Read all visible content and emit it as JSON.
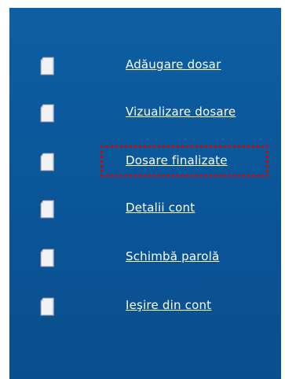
{
  "menu": {
    "items": [
      {
        "label": "Adăugare dosar",
        "icon": "document-icon"
      },
      {
        "label": "Vizualizare dosare",
        "icon": "document-icon"
      },
      {
        "label": "Dosare finalizate",
        "icon": "document-icon",
        "focused": true
      },
      {
        "label": "Detalii cont",
        "icon": "document-icon"
      },
      {
        "label": "Schimbă parolă",
        "icon": "document-icon"
      },
      {
        "label": "Ieşire din cont",
        "icon": "document-icon"
      }
    ]
  },
  "colors": {
    "panel_background": "#0a5597",
    "link_text": "#ffffff",
    "focus_outline": "#e00000",
    "page_background": "#ffffff"
  }
}
